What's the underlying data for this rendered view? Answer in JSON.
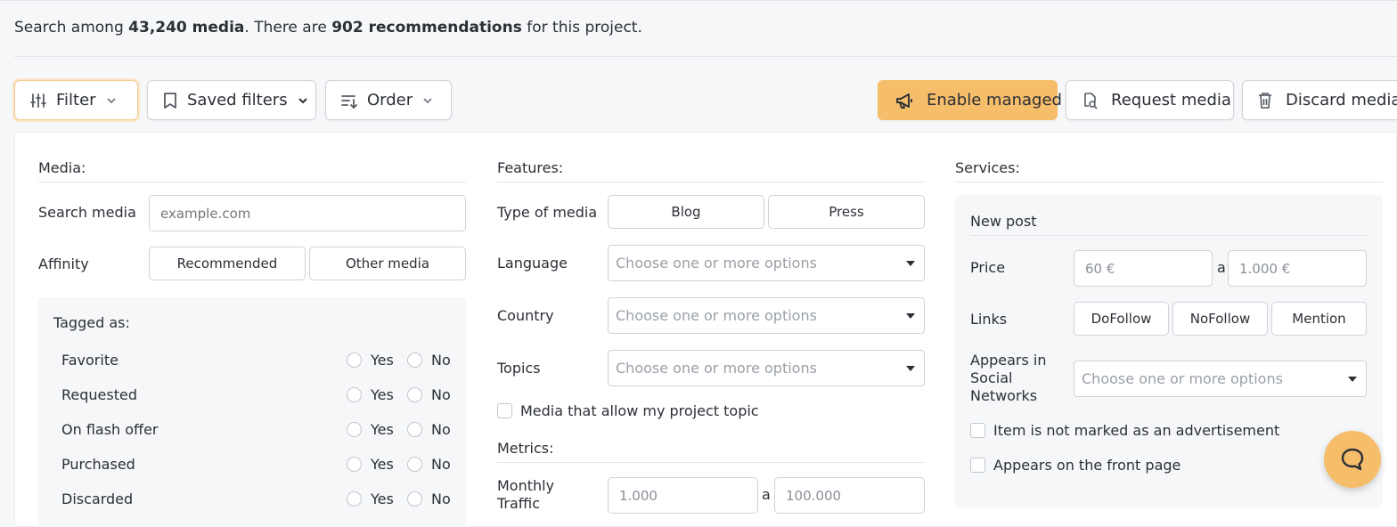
{
  "summary": {
    "prefix": "Search among ",
    "media_count": "43,240 media",
    "middle": ". There are ",
    "recommendations": "902 recommendations",
    "suffix": " for this project."
  },
  "toolbar": {
    "filter": "Filter",
    "saved_filters": "Saved filters",
    "order": "Order",
    "enable_managed": "Enable managed",
    "request_media": "Request media",
    "discard_media": "Discard media"
  },
  "media": {
    "title": "Media:",
    "search_label": "Search media",
    "search_placeholder": "example.com",
    "affinity_label": "Affinity",
    "affinity_options": [
      "Recommended",
      "Other media"
    ],
    "tagged_title": "Tagged as:",
    "tags": [
      {
        "label": "Favorite",
        "yes": "Yes",
        "no": "No"
      },
      {
        "label": "Requested",
        "yes": "Yes",
        "no": "No"
      },
      {
        "label": "On flash offer",
        "yes": "Yes",
        "no": "No"
      },
      {
        "label": "Purchased",
        "yes": "Yes",
        "no": "No"
      },
      {
        "label": "Discarded",
        "yes": "Yes",
        "no": "No"
      }
    ]
  },
  "features": {
    "title": "Features:",
    "type_label": "Type of media",
    "type_options": [
      "Blog",
      "Press"
    ],
    "language_label": "Language",
    "country_label": "Country",
    "topics_label": "Topics",
    "select_placeholder": "Choose one or more options",
    "allow_topic": "Media that allow my project topic",
    "metrics_title": "Metrics:",
    "traffic_label": "Monthly Traffic",
    "traffic_min": "1.000",
    "traffic_max": "100.000",
    "range_sep": "a"
  },
  "services": {
    "title": "Services:",
    "new_post": "New post",
    "price_label": "Price",
    "price_min": "60 €",
    "price_max": "1.000 €",
    "range_sep": "a",
    "links_label": "Links",
    "links_options": [
      "DoFollow",
      "NoFollow",
      "Mention"
    ],
    "social_label": "Appears in Social Networks",
    "select_placeholder": "Choose one or more options",
    "not_ad": "Item is not marked as an advertisement",
    "front_page": "Appears on the front page"
  },
  "colors": {
    "accent": "#f6be6a",
    "border": "#cfd3d9",
    "text": "#2b2f36",
    "placeholder": "#9aa0a8"
  }
}
